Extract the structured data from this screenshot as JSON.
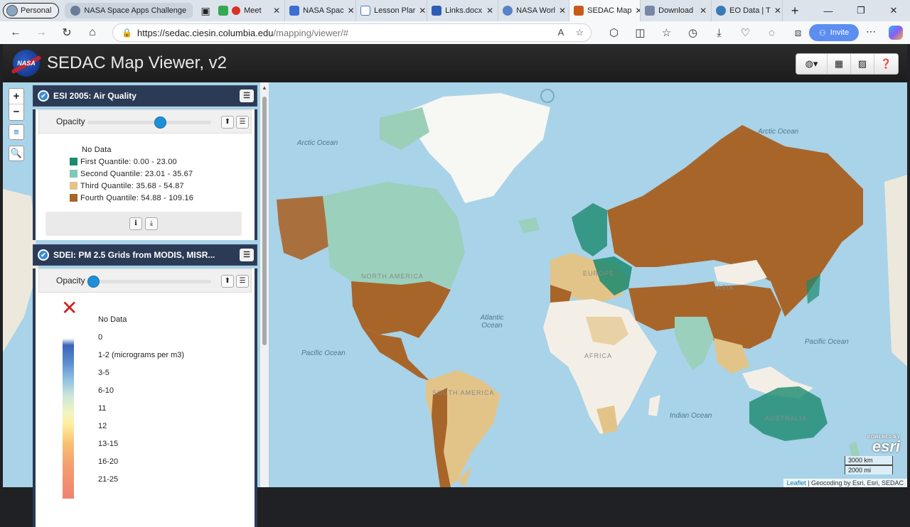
{
  "browser": {
    "profile": "Personal",
    "tabs": [
      {
        "label": "NASA Space Apps Challenge",
        "icon": "globe-icon",
        "group": true
      },
      {
        "label": "",
        "icon": "tab-actions-icon"
      },
      {
        "label": "Meet",
        "icon": "meet-icon"
      },
      {
        "label": "NASA Spac",
        "icon": "nasa-icon"
      },
      {
        "label": "Lesson Plar",
        "icon": "doc-icon"
      },
      {
        "label": "Links.docx",
        "icon": "word-icon"
      },
      {
        "label": "NASA Worl",
        "icon": "globe-icon"
      },
      {
        "label": "SEDAC Map",
        "icon": "sedac-icon",
        "active": true
      },
      {
        "label": "Download",
        "icon": "download-page-icon"
      },
      {
        "label": "EO Data | T",
        "icon": "earth-icon"
      }
    ],
    "url_prefix": "https://sedac.ciesin.columbia.edu",
    "url_rest": "/mapping/viewer/#",
    "invite_label": "Invite"
  },
  "app": {
    "logo_text": "NASA",
    "title": "SEDAC Map Viewer, v2"
  },
  "map": {
    "labels": {
      "arctic_ocean_left": "Arctic Ocean",
      "arctic_ocean_right": "Arctic Ocean",
      "north_america": "NORTH AMERICA",
      "europe": "EUROPE",
      "asia": "ASIA",
      "atlantic": "Atlantic Ocean",
      "pacific_left": "Pacific Ocean",
      "pacific_right": "Pacific Ocean",
      "africa": "AFRICA",
      "south_america": "SOUTH AMERICA",
      "indian": "Indian Ocean",
      "australia": "AUSTRALIA"
    },
    "zoom_in": "+",
    "zoom_out": "−",
    "scale_km": "3000 km",
    "scale_mi": "2000 mi",
    "esri_powered": "POWERED BY",
    "esri": "esri",
    "attribution_leaflet": "Leaflet",
    "attribution_rest": " | Geocoding by Esri, Esri, SEDAC"
  },
  "layers": [
    {
      "title": "ESI 2005: Air Quality",
      "opacity_label": "Opacity",
      "opacity": 0.6,
      "legend": [
        {
          "label": "No Data",
          "color": "#ffffff"
        },
        {
          "label": "First Quantile: 0.00 - 23.00",
          "color": "#1b8a6e"
        },
        {
          "label": "Second Quantile: 23.01 - 35.67",
          "color": "#7fc9b8"
        },
        {
          "label": "Third Quantile: 35.68 - 54.87",
          "color": "#e3c488"
        },
        {
          "label": "Fourth Quantile: 54.88 - 109.16",
          "color": "#a8652a"
        }
      ]
    },
    {
      "title": "SDEI: PM 2.5 Grids from MODIS, MISR...",
      "opacity_label": "Opacity",
      "opacity": 0.0,
      "legend": [
        {
          "label": "No Data"
        },
        {
          "label": "0"
        },
        {
          "label": "1-2 (micrograms per m3)"
        },
        {
          "label": "3-5"
        },
        {
          "label": "6-10"
        },
        {
          "label": "11"
        },
        {
          "label": "12"
        },
        {
          "label": "13-15"
        },
        {
          "label": "16-20"
        },
        {
          "label": "21-25"
        }
      ]
    }
  ]
}
